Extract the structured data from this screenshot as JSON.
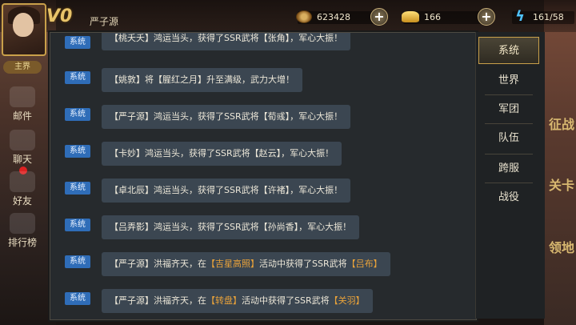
{
  "player": {
    "vip": "V0",
    "name": "严子源",
    "home_label": "主界"
  },
  "resources": {
    "coins": "623428",
    "ingots": "166",
    "energy": "161/58"
  },
  "left_menu": [
    {
      "label": "邮件"
    },
    {
      "label": "聊天"
    },
    {
      "label": "好友"
    },
    {
      "label": "排行榜"
    }
  ],
  "right_deco": [
    "征战",
    "关卡",
    "领地"
  ],
  "tabs": [
    {
      "label": "系统",
      "active": true
    },
    {
      "label": "世界",
      "active": false
    },
    {
      "label": "军团",
      "active": false
    },
    {
      "label": "队伍",
      "active": false
    },
    {
      "label": "跨服",
      "active": false
    },
    {
      "label": "战役",
      "active": false
    }
  ],
  "messages": [
    {
      "tag": "系统",
      "pre": "【桃夭夭】鸿运当头，获得了SSR武将【张角】，军心大振！",
      "hl1": "",
      "mid": "",
      "hl2": "",
      "post": ""
    },
    {
      "tag": "系统",
      "pre": "【姚敦】将【腥红之月】升至满级，武力大增！",
      "hl1": "",
      "mid": "",
      "hl2": "",
      "post": ""
    },
    {
      "tag": "系统",
      "pre": "【严子源】鸿运当头，获得了SSR武将【荀彧】，军心大振！",
      "hl1": "",
      "mid": "",
      "hl2": "",
      "post": ""
    },
    {
      "tag": "系统",
      "pre": "【卡妙】鸿运当头，获得了SSR武将【赵云】，军心大振！",
      "hl1": "",
      "mid": "",
      "hl2": "",
      "post": ""
    },
    {
      "tag": "系统",
      "pre": "【卓北辰】鸿运当头，获得了SSR武将【许褚】，军心大振！",
      "hl1": "",
      "mid": "",
      "hl2": "",
      "post": ""
    },
    {
      "tag": "系统",
      "pre": "【吕弄影】鸿运当头，获得了SSR武将【孙尚香】，军心大振！",
      "hl1": "",
      "mid": "",
      "hl2": "",
      "post": ""
    },
    {
      "tag": "系统",
      "pre": "【严子源】洪福齐天，在",
      "hl1": "【吉星高照】",
      "mid": "活动中获得了SSR武将",
      "hl2": "【吕布】",
      "post": ""
    },
    {
      "tag": "系统",
      "pre": "【严子源】洪福齐天，在",
      "hl1": "【转盘】",
      "mid": "活动中获得了SSR武将",
      "hl2": "【关羽】",
      "post": ""
    }
  ],
  "colors": {
    "tag_blue": "#2f6db8",
    "highlight_orange": "#e8a23a",
    "active_tab_border": "#c9a04a"
  }
}
